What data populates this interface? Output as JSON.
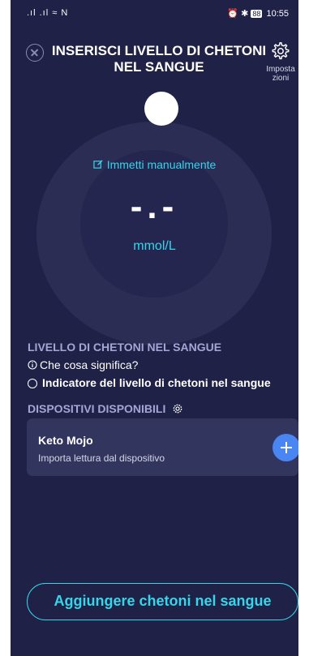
{
  "status_bar": {
    "signal": ".ıl .ıl ≈ N",
    "battery": "88",
    "time": "10:55"
  },
  "header": {
    "title": "INSERISCI LIVELLO DI CHETONI NEL SANGUE",
    "settings_label": "Imposta zioni"
  },
  "dial": {
    "manual_entry": "Immetti manualmente",
    "value": "-.-",
    "unit": "mmol/L"
  },
  "info": {
    "section_title": "LIVELLO DI CHETONI NEL SANGUE",
    "what_means": "Che cosa significa?",
    "indicator": "Indicatore del livello di chetoni nel sangue"
  },
  "devices": {
    "section_title": "DISPOSITIVI DISPONIBILI",
    "items": [
      {
        "name": "Keto Mojo",
        "subtitle": "Importa lettura dal dispositivo"
      }
    ]
  },
  "cta": {
    "label": "Aggiungere chetoni nel sangue"
  },
  "colors": {
    "background": "#1f2146",
    "accent": "#35d6e9",
    "add_button": "#4a86f3"
  }
}
